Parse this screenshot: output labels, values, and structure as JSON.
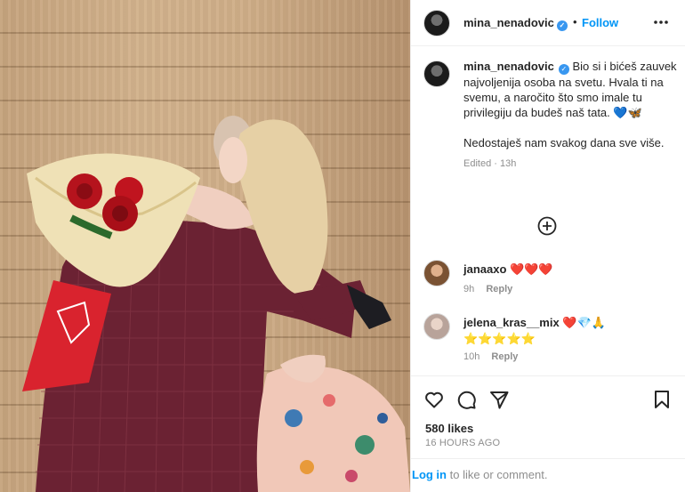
{
  "post": {
    "username": "mina_nenadovic",
    "header_dot": "•",
    "follow_label": "Follow",
    "photo_alt": "mina_nenadovic hugging her father, holding red roses"
  },
  "caption": {
    "username": "mina_nenadovic",
    "text_1": "Bio si i bićeš zauvek najvoljenija osoba na svetu. Hvala ti na svemu, a naročito što smo imale tu privilegiju da budeš naš tata. 💙🦋",
    "text_2": "Nedostaješ nam svakog dana sve više.",
    "meta": "Edited · 13h"
  },
  "comments": [
    {
      "username": "janaaxo",
      "text": "❤️❤️❤️",
      "time": "9h",
      "reply_label": "Reply"
    },
    {
      "username": "jelena_kras__mix",
      "text": "❤️💎🙏 ⭐⭐⭐⭐⭐",
      "time": "10h",
      "reply_label": "Reply"
    }
  ],
  "stats": {
    "likes": "580 likes",
    "time_ago": "16 HOURS AGO"
  },
  "login": {
    "link": "Log in",
    "suffix": " to like or comment."
  },
  "icons": {
    "more": "more-options-icon",
    "load_more": "plus-circle-icon",
    "like": "heart-icon",
    "comment": "comment-icon",
    "share": "paper-plane-icon",
    "save": "bookmark-icon",
    "verified": "verified-badge-icon"
  },
  "colors": {
    "accent": "#0095f6",
    "verified": "#3897f0",
    "text": "#262626",
    "muted": "#8e8e8e"
  }
}
